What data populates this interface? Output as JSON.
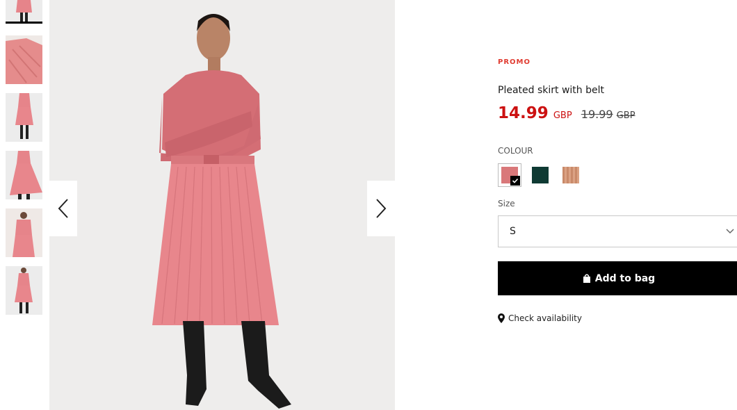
{
  "product": {
    "promo_label": "PROMO",
    "title": "Pleated skirt with belt",
    "price_current": "14.99",
    "currency_current": "GBP",
    "price_old": "19.99",
    "currency_old": "GBP"
  },
  "colour": {
    "label": "COLOUR",
    "swatches": [
      {
        "name": "pink",
        "color": "#d9787a",
        "selected": true
      },
      {
        "name": "dark-green",
        "color": "#0f3a33",
        "selected": false
      },
      {
        "name": "copper",
        "color": "#c98a6a",
        "selected": false
      }
    ]
  },
  "size": {
    "label": "Size",
    "selected": "S"
  },
  "actions": {
    "add_to_bag": "Add to bag",
    "check_availability": "Check availability"
  },
  "colors": {
    "promo": "#e03c31",
    "price": "#cc1111",
    "product_pink": "#e6848a"
  },
  "gallery": {
    "thumbnail_count": 6,
    "active_thumbnail": 0,
    "icons": [
      "chevron-left-icon",
      "chevron-right-icon",
      "bag-icon",
      "location-pin-icon",
      "check-icon",
      "chevron-down-icon"
    ]
  }
}
